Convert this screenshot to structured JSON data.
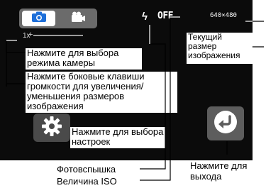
{
  "screen": {
    "mode_switch": {
      "photo_icon": "camera-icon",
      "video_icon": "video-camera-icon",
      "selected": "photo"
    },
    "zoom": {
      "label": "1x",
      "plus": "+"
    },
    "status": {
      "flash_icon": "flash-icon",
      "flash_glyph": "ϟ",
      "iso_value": "OFF",
      "resolution": "640×480"
    },
    "settings_icon": "gear-icon",
    "exit_icon": "return-arrow-icon"
  },
  "callouts": {
    "mode": "Нажмите для выбора режима камеры",
    "zoom": "Нажмите боковые клавиши громкости для увеличения/уменьшения размеров изображения",
    "settings": "Нажмите для выбора настроек",
    "resolution": "Текущий размер изображения"
  },
  "labels": {
    "flash": "Фотовспышка",
    "iso": "Величина ISO",
    "exit": "Нажмите для выхода"
  },
  "colors": {
    "screen_bg": "#0b0b0b",
    "photo_icon": "#1e6fd9"
  }
}
